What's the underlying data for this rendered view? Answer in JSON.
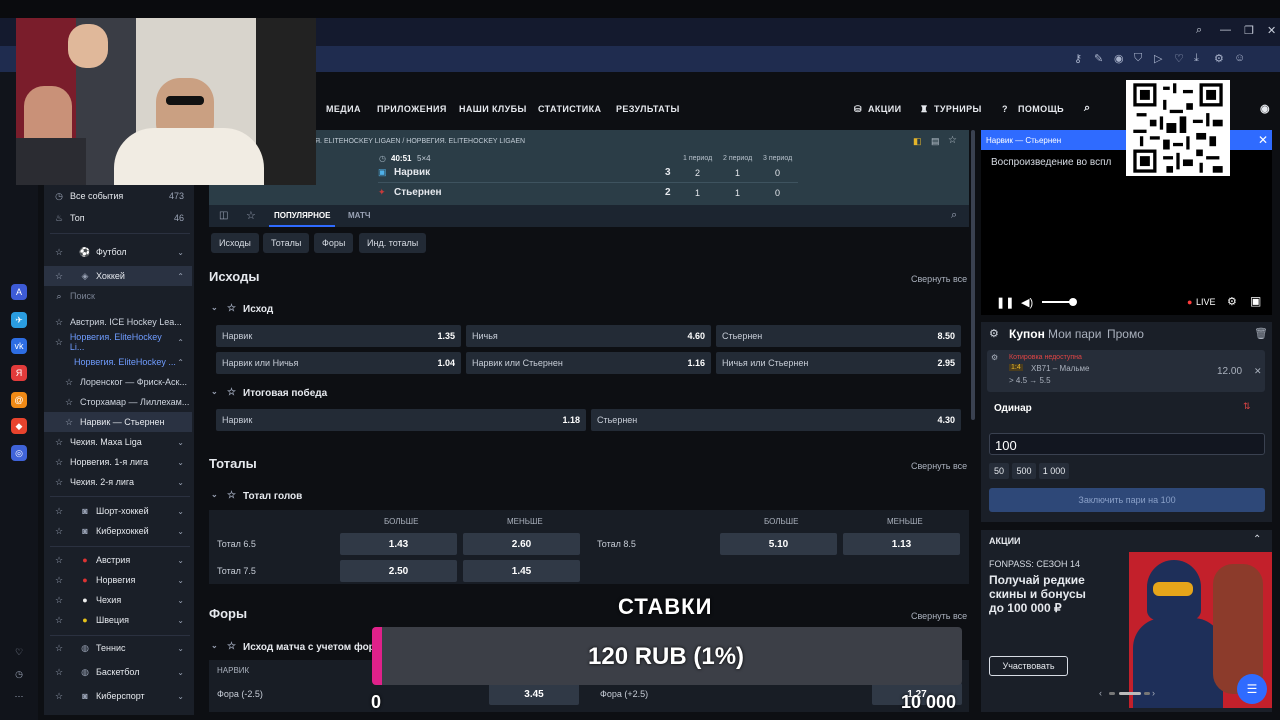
{
  "colors": {
    "accent": "#2f6bff",
    "live": "#ff3b3b",
    "pink": "#e0218a",
    "promo_red": "#c3202b"
  },
  "nav": {
    "items": [
      "МЕДИА",
      "ПРИЛОЖЕНИЯ",
      "НАШИ КЛУБЫ",
      "СТАТИСТИКА",
      "РЕЗУЛЬТАТЫ"
    ],
    "promo": "АКЦИИ",
    "tournaments": "ТУРНИРЫ",
    "help": "ПОМОЩЬ"
  },
  "sidebar": {
    "all_events": "Все события",
    "all_count": "473",
    "top": "Топ",
    "top_count": "46",
    "football": "Футбол",
    "hockey": "Хоккей",
    "search_placeholder": "Поиск",
    "leagues": [
      "Австрия. ICE Hockey Lea...",
      "Норвегия. EliteHockey Li...",
      "Норвегия. EliteHockey ...",
      "Лоренског — Фриск-Аск...",
      "Сторхамар — Лиллехам...",
      "Нарвик — Стьернен",
      "Чехия. Maxa Liga",
      "Норвегия. 1-я лига",
      "Чехия. 2-я лига"
    ],
    "short_hockey": "Шорт-хоккей",
    "cyber_hockey": "Киберхоккей",
    "countries": [
      "Австрия",
      "Норвегия",
      "Чехия",
      "Швеция"
    ],
    "tennis": "Теннис",
    "basketball": "Баскетбол",
    "esports": "Киберспорт"
  },
  "match": {
    "breadcrumb": "Я. ELITEHOCKEY LIGAEN / НОРВЕГИЯ. ELITEHOCKEY LIGAEN",
    "time": "40:51",
    "format": "5×4",
    "periods": [
      "1 период",
      "2 период",
      "3 период"
    ],
    "team1": "Нарвик",
    "team1_score": "3",
    "team1_p": [
      "2",
      "1",
      "0"
    ],
    "team2": "Стьернен",
    "team2_score": "2",
    "team2_p": [
      "1",
      "1",
      "0"
    ],
    "tab_popular": "ПОПУЛЯРНОЕ",
    "tab_match": "МАТЧ"
  },
  "filters": [
    "Исходы",
    "Тоталы",
    "Форы",
    "Инд. тоталы"
  ],
  "outcomes": {
    "title": "Исходы",
    "collapse": "Свернуть все",
    "market1": "Исход",
    "row1": [
      {
        "n": "Нарвик",
        "v": "1.35"
      },
      {
        "n": "Ничья",
        "v": "4.60"
      },
      {
        "n": "Стьернен",
        "v": "8.50"
      }
    ],
    "row2": [
      {
        "n": "Нарвик или Ничья",
        "v": "1.04"
      },
      {
        "n": "Нарвик или Стьернен",
        "v": "1.16"
      },
      {
        "n": "Ничья или Стьернен",
        "v": "2.95"
      }
    ],
    "market2": "Итоговая победа",
    "row3": [
      {
        "n": "Нарвик",
        "v": "1.18"
      },
      {
        "n": "Стьернен",
        "v": "4.30"
      }
    ]
  },
  "totals": {
    "title": "Тоталы",
    "collapse": "Свернуть все",
    "market": "Тотал голов",
    "over": "БОЛЬШЕ",
    "under": "МЕНЬШЕ",
    "rows": [
      {
        "label": "Тотал 6.5",
        "over": "1.43",
        "under": "2.60"
      },
      {
        "label": "Тотал 7.5",
        "over": "2.50",
        "under": "1.45"
      }
    ],
    "right": {
      "label": "Тотал 8.5",
      "over": "5.10",
      "under": "1.13"
    }
  },
  "handicaps": {
    "title": "Форы",
    "collapse": "Свернуть все",
    "market": "Исход матча с учетом фор",
    "col": "НАРВИК",
    "left_label": "Фора (-2.5)",
    "left_value": "3.45",
    "right_label": "Фора (+2.5)",
    "right_value": "1.27"
  },
  "video": {
    "title": "Нарвик — Стьернен",
    "message": "Воспроизведение во вспл",
    "live": "LIVE"
  },
  "coupon": {
    "tab1": "Купон",
    "tab2": "Мои пари",
    "tab3": "Промо",
    "warning": "Котировка недоступна",
    "market": "1:4",
    "event": "ХВ71 – Мальме",
    "change": "> 4.5 → 5.5",
    "odds": "12.00",
    "type": "Одинар",
    "amount": "100",
    "quick": [
      "50",
      "500",
      "1 000"
    ],
    "submit": "Заключить пари на 100"
  },
  "promo": {
    "title": "АКЦИИ",
    "season": "FONPASS: СЕЗОН 14",
    "text1": "Получай редкие",
    "text2": "скины и бонусы",
    "text3": "до 100 000 ₽",
    "button": "Участвовать"
  },
  "overlay": {
    "label": "СТАВКИ",
    "amount": "120 RUB (1%)",
    "min": "0",
    "max": "10 000",
    "progress": 0.01
  }
}
